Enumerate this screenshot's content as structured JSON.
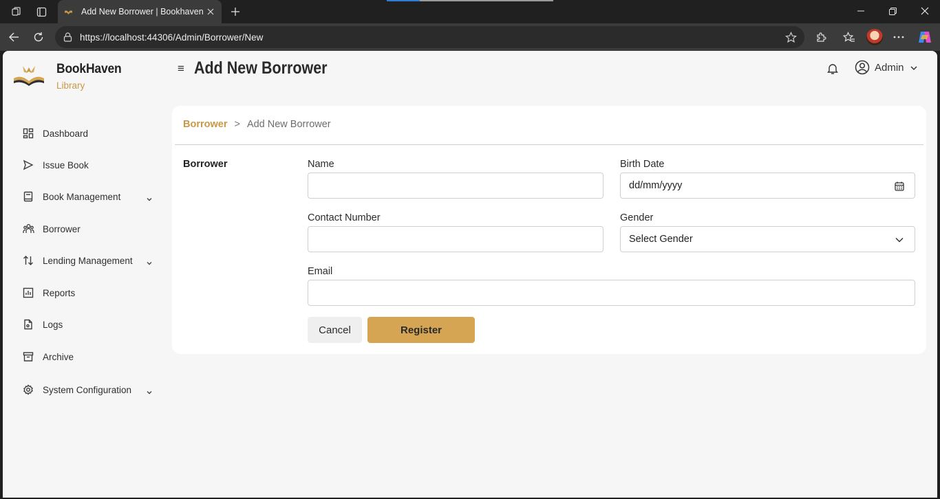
{
  "browser": {
    "tab_title": "Add New Borrower | Bookhaven",
    "url": "https://localhost:44306/Admin/Borrower/New"
  },
  "brand": {
    "name": "BookHaven",
    "subtitle": "Library"
  },
  "header": {
    "title": "Add New Borrower",
    "menu_glyph": "≡",
    "user_name": "Admin"
  },
  "sidebar": {
    "items": [
      {
        "label": "Dashboard",
        "icon": "dashboard-icon"
      },
      {
        "label": "Issue Book",
        "icon": "send-icon"
      },
      {
        "label": "Book Management",
        "icon": "book-icon",
        "expandable": true
      },
      {
        "label": "Borrower",
        "icon": "people-icon"
      },
      {
        "label": "Lending Management",
        "icon": "swap-icon",
        "expandable": true
      },
      {
        "label": "Reports",
        "icon": "chart-icon"
      },
      {
        "label": "Logs",
        "icon": "file-icon"
      },
      {
        "label": "Archive",
        "icon": "archive-icon"
      },
      {
        "label": "System Configuration",
        "icon": "gear-icon",
        "expandable": true
      }
    ]
  },
  "breadcrumb": {
    "parent": "Borrower",
    "separator": ">",
    "current": "Add New Borrower"
  },
  "form": {
    "section_title": "Borrower",
    "name_label": "Name",
    "name_value": "",
    "birth_date_label": "Birth Date",
    "birth_date_placeholder": "dd/mm/yyyy",
    "contact_label": "Contact Number",
    "contact_value": "",
    "gender_label": "Gender",
    "gender_selected": "Select Gender",
    "email_label": "Email",
    "email_value": "",
    "cancel_label": "Cancel",
    "register_label": "Register"
  },
  "colors": {
    "accent": "#c99845",
    "register_button": "#d5a553"
  }
}
